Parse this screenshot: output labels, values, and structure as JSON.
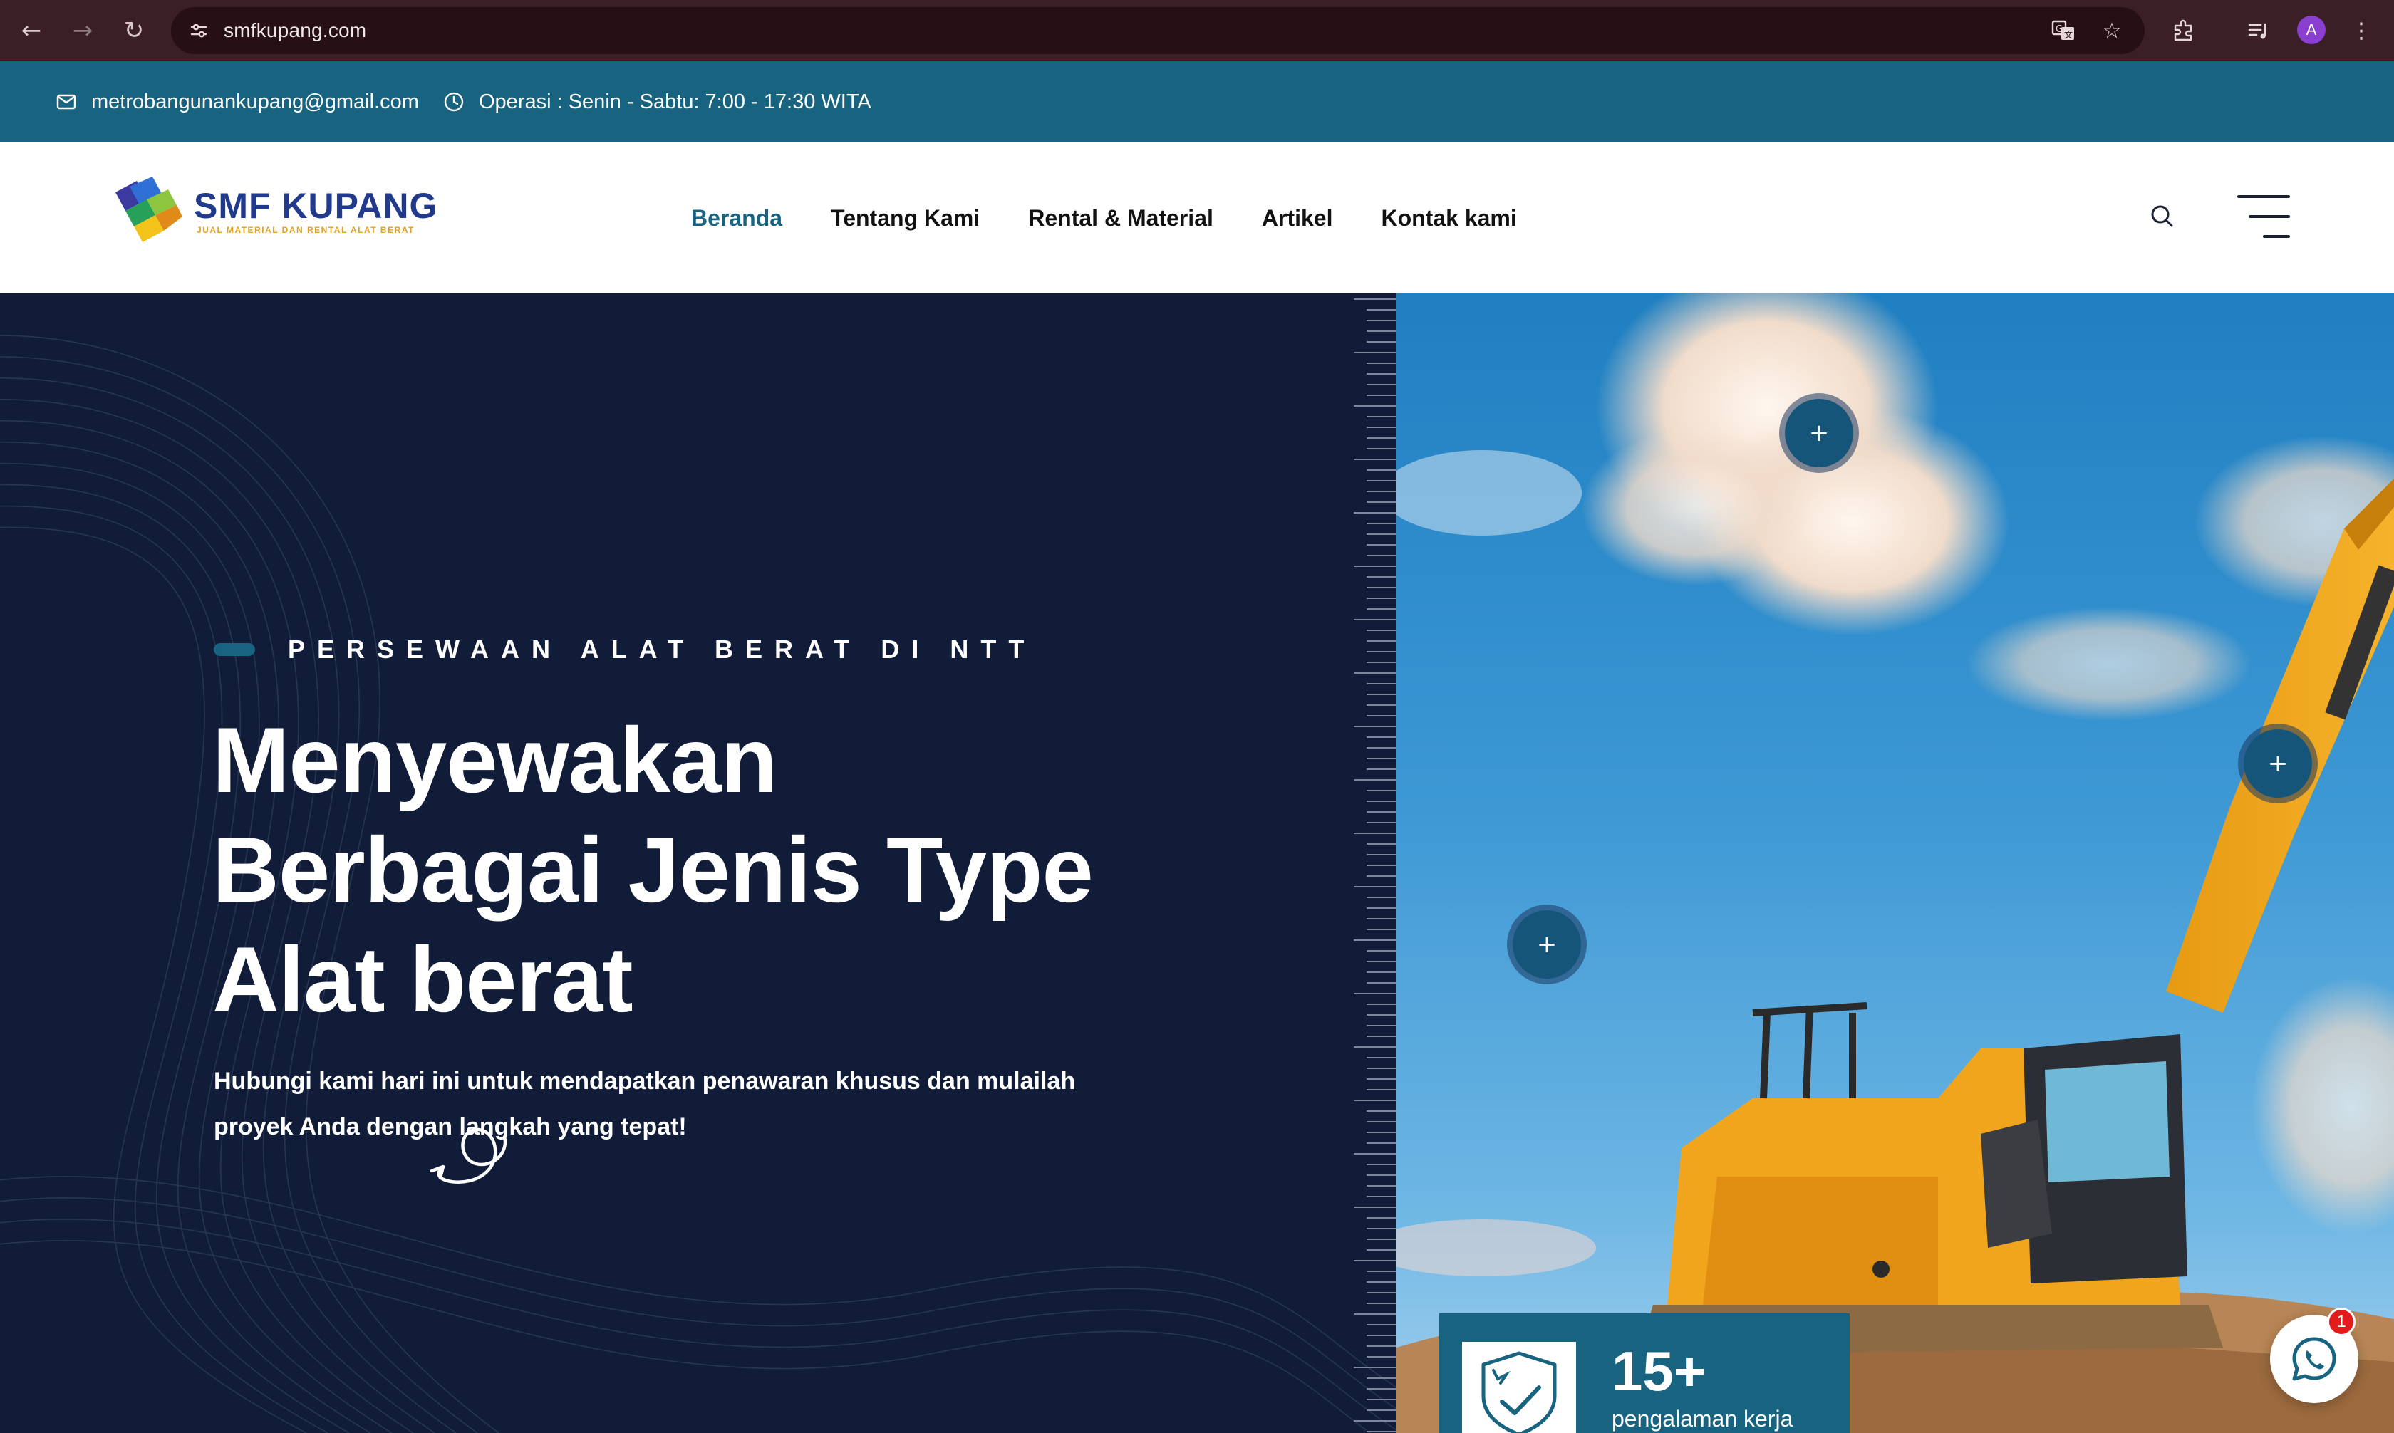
{
  "browser": {
    "url": "smfkupang.com",
    "profile_initial": "A",
    "icons": [
      "back-arrow-icon",
      "forward-arrow-icon",
      "reload-icon",
      "site-settings-icon",
      "translate-icon",
      "bookmark-star-icon",
      "extensions-icon",
      "media-controls-icon",
      "kebab-menu-icon"
    ]
  },
  "topbar": {
    "email": "metrobangunankupang@gmail.com",
    "hours": "Operasi : Senin - Sabtu: 7:00 - 17:30 WITA",
    "background": "#18637f"
  },
  "header": {
    "logo_name": "SMF KUPANG",
    "logo_tagline": "JUAL MATERIAL DAN RENTAL ALAT BERAT",
    "nav": [
      {
        "label": "Beranda",
        "active": true
      },
      {
        "label": "Tentang Kami",
        "active": false
      },
      {
        "label": "Rental & Material",
        "active": false
      },
      {
        "label": "Artikel",
        "active": false
      },
      {
        "label": "Kontak kami",
        "active": false
      }
    ]
  },
  "hero": {
    "eyebrow": "PERSEWAAN ALAT BERAT DI NTT",
    "headline": [
      "Menyewakan",
      "Berbagai Jenis Type",
      "Alat berat"
    ],
    "subtext": "Hubungi kami hari ini untuk mendapatkan penawaran khusus dan mulailah proyek Anda dengan langkah yang tepat!",
    "hotspot_label": "+",
    "background": "#111d38",
    "accent": "#18637f"
  },
  "stat": {
    "number": "15+",
    "label": "pengalaman kerja"
  },
  "whatsapp": {
    "badge_count": "1"
  }
}
